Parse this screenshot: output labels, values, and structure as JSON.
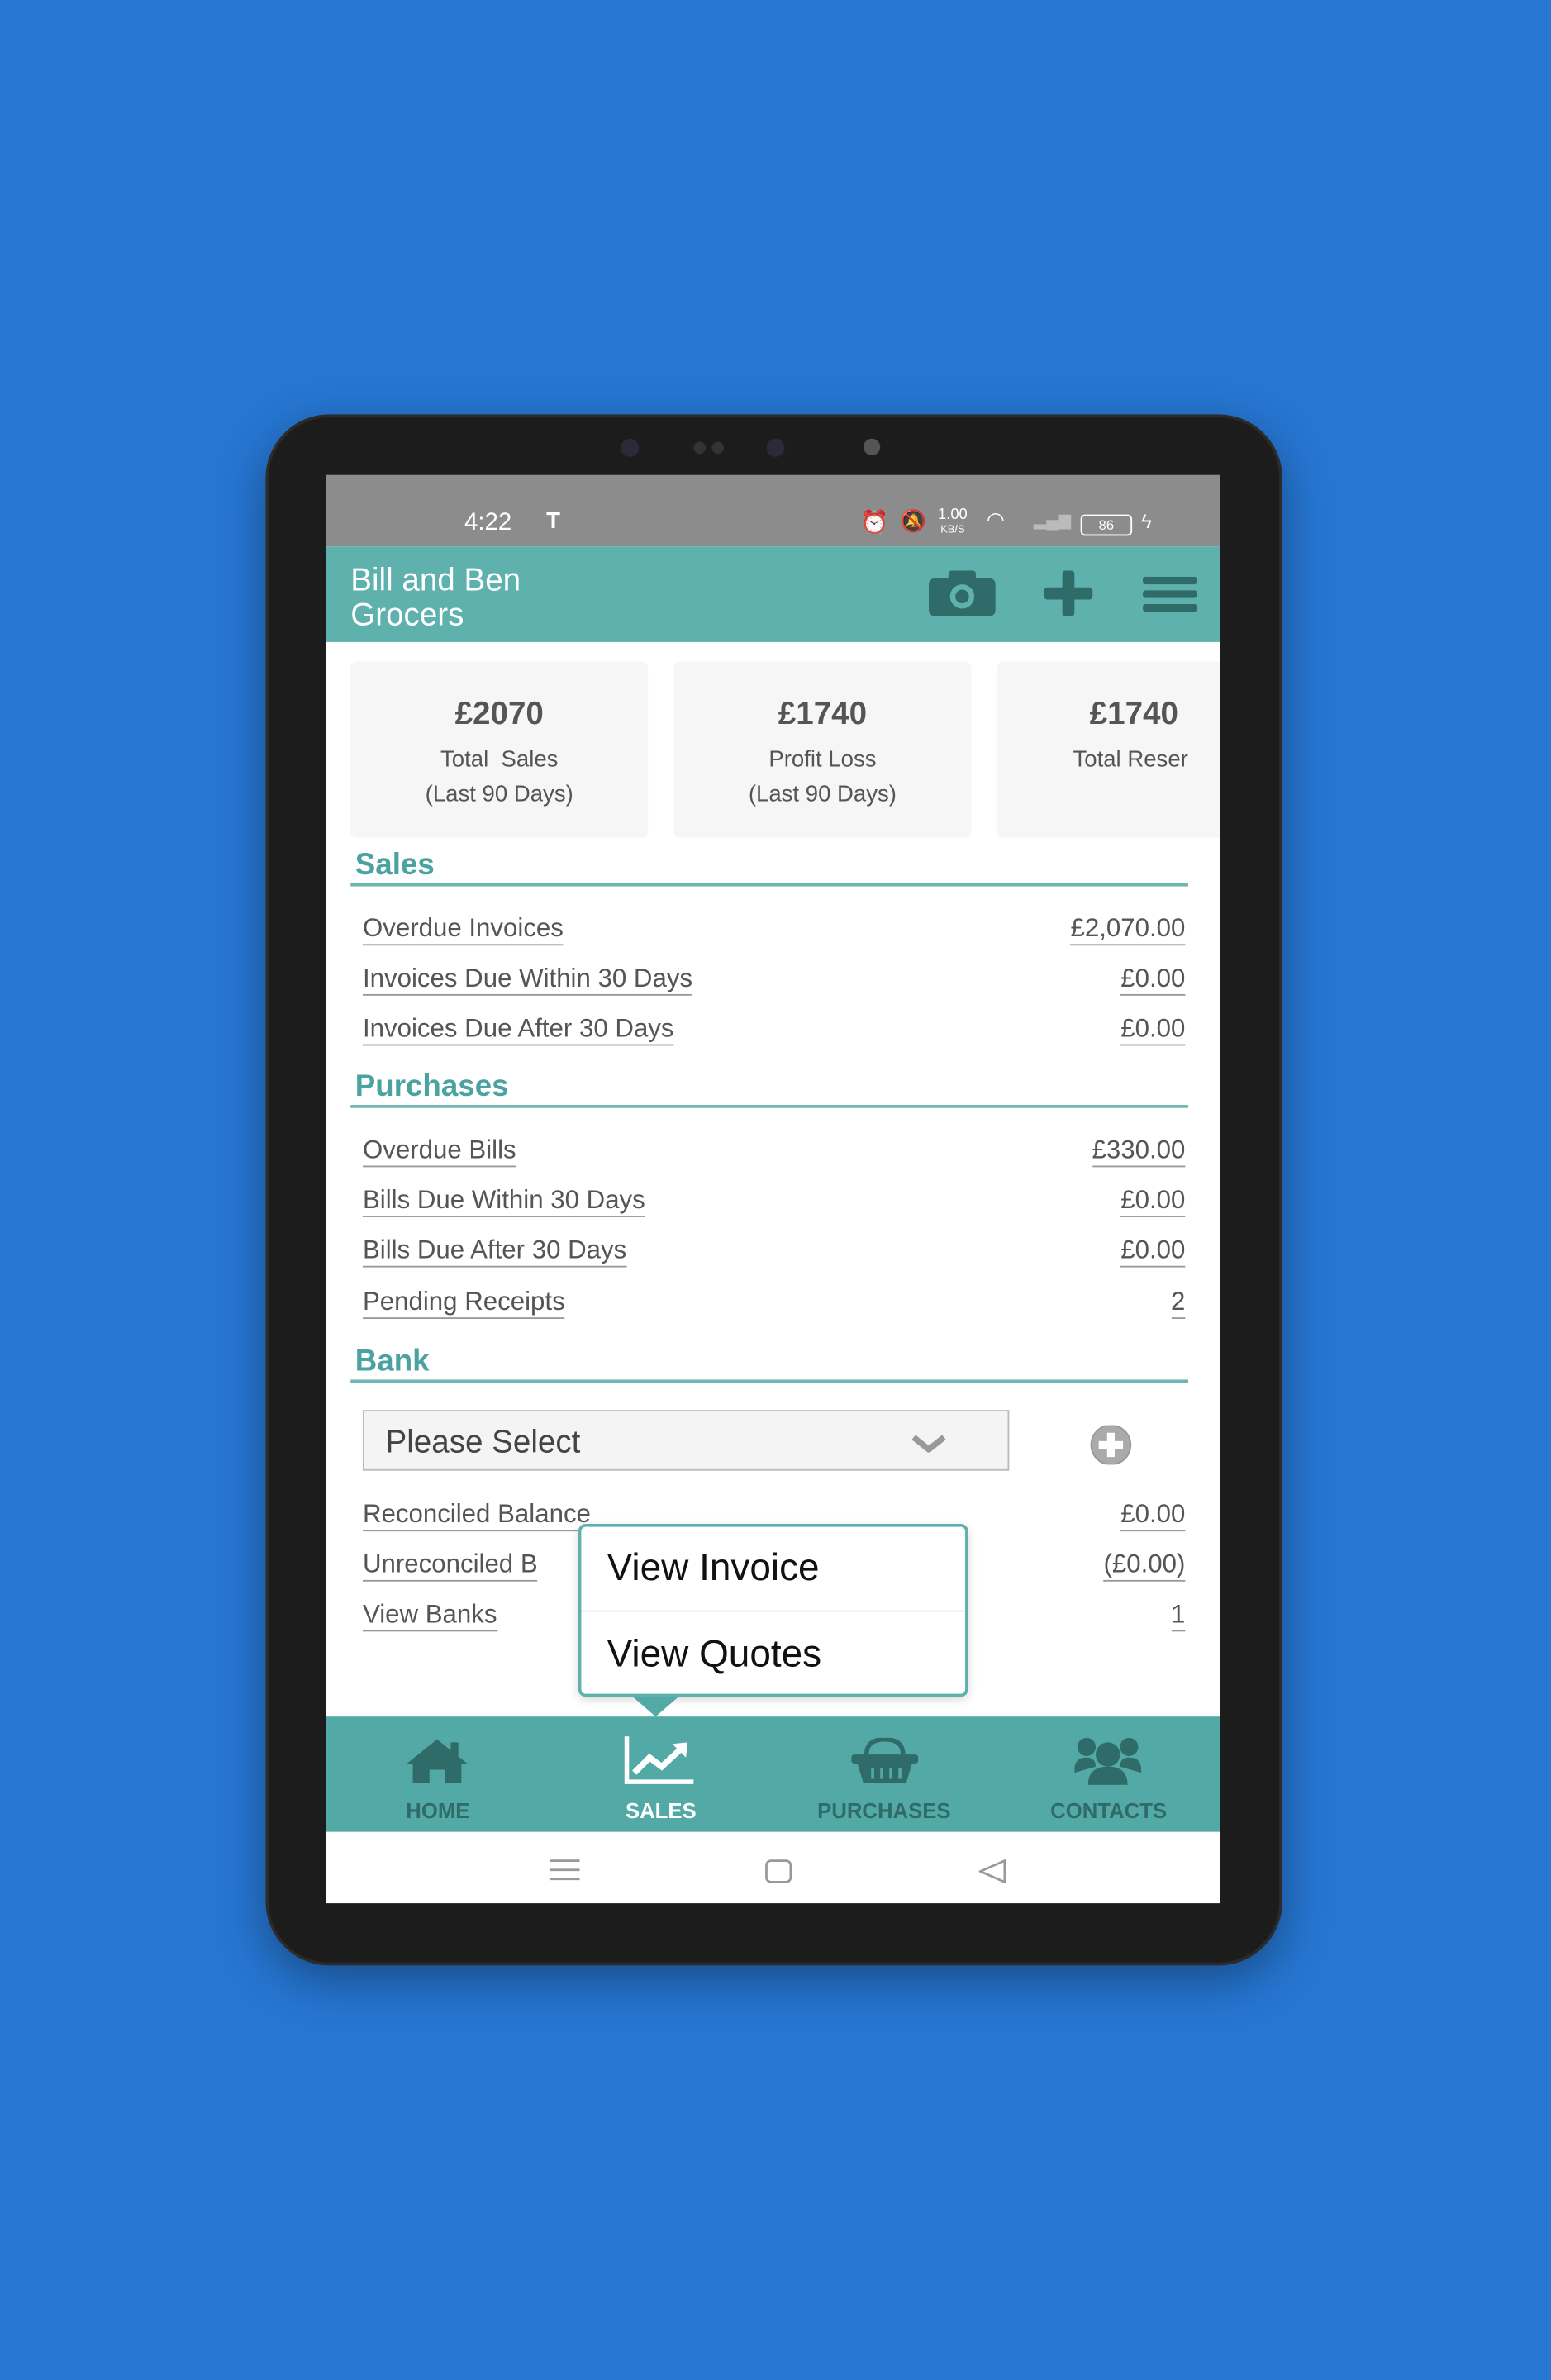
{
  "status_bar": {
    "time": "4:22",
    "net_speed": "1.00",
    "net_unit": "KB/S",
    "battery": "86"
  },
  "header": {
    "title_line1": "Bill and Ben",
    "title_line2": "Grocers",
    "icons": [
      "camera-icon",
      "plus-icon",
      "menu-icon"
    ]
  },
  "cards": [
    {
      "amount": "£2070",
      "label": "Total  Sales",
      "sub": "(Last 90 Days)"
    },
    {
      "amount": "£1740",
      "label": "Profit Loss",
      "sub": "(Last 90 Days)"
    },
    {
      "amount": "£1740",
      "label": "Total Reser",
      "sub": ""
    }
  ],
  "sales": {
    "heading": "Sales",
    "rows": [
      {
        "label": "Overdue Invoices",
        "value": "£2,070.00"
      },
      {
        "label": "Invoices Due Within 30 Days",
        "value": "£0.00"
      },
      {
        "label": "Invoices Due After 30 Days",
        "value": "£0.00"
      }
    ]
  },
  "purchases": {
    "heading": "Purchases",
    "rows": [
      {
        "label": "Overdue Bills",
        "value": "£330.00"
      },
      {
        "label": "Bills Due Within 30 Days",
        "value": "£0.00"
      },
      {
        "label": "Bills Due After 30 Days",
        "value": "£0.00"
      },
      {
        "label": "Pending Receipts",
        "value": "2"
      }
    ]
  },
  "bank": {
    "heading": "Bank",
    "select_value": "Please Select",
    "rows": [
      {
        "label": "Reconciled Balance",
        "value": "£0.00"
      },
      {
        "label": "Unreconciled B",
        "value": "(£0.00)"
      },
      {
        "label": "View Banks",
        "value": "1"
      }
    ]
  },
  "popup": {
    "items": [
      "View Invoice",
      "View Quotes"
    ]
  },
  "nav": {
    "items": [
      {
        "label": "HOME",
        "icon": "home-icon"
      },
      {
        "label": "SALES",
        "icon": "chart-line-icon",
        "active": true
      },
      {
        "label": "PURCHASES",
        "icon": "basket-icon"
      },
      {
        "label": "CONTACTS",
        "icon": "users-icon"
      }
    ]
  },
  "colors": {
    "background": "#2676d2",
    "teal": "#5fb1ae",
    "nav_teal": "#52a9a6",
    "icon_dark": "#2f6b68",
    "heading": "#4aa3a0"
  }
}
